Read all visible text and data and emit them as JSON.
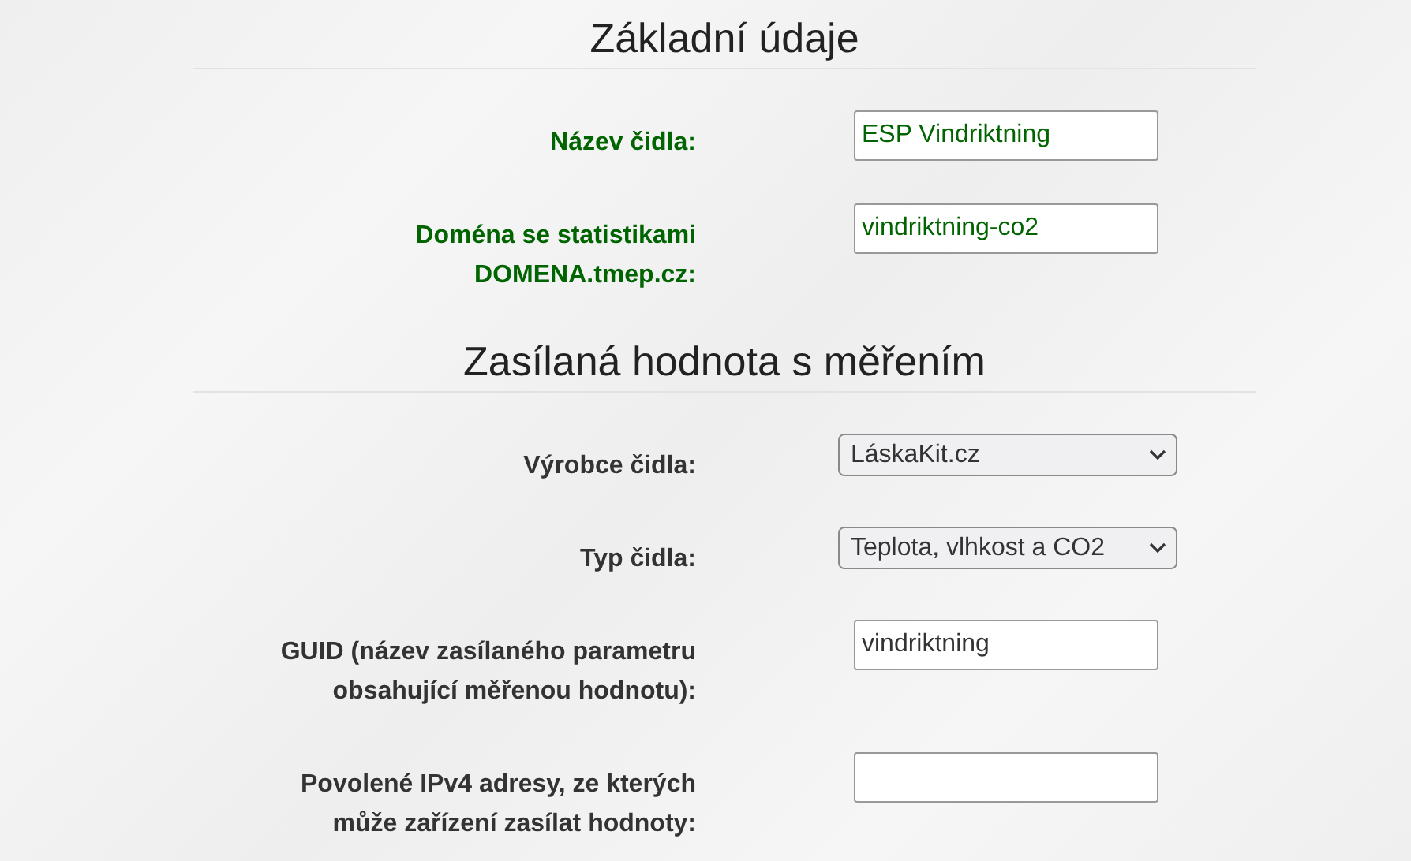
{
  "sections": [
    {
      "title": "Základní údaje",
      "color": "#006400",
      "fields": [
        {
          "kind": "text",
          "label": "Název čidla:",
          "value": "ESP Vindriktning"
        },
        {
          "kind": "text",
          "label": "Doména se statistikami DOMENA.tmep.cz:",
          "value": "vindriktning-co2"
        }
      ]
    },
    {
      "title": "Zasílaná hodnota s měřením",
      "color": "#333333",
      "fields": [
        {
          "kind": "select",
          "label": "Výrobce čidla:",
          "value": "LáskaKit.cz"
        },
        {
          "kind": "select",
          "label": "Typ čidla:",
          "value": "Teplota, vlhkost a CO2"
        },
        {
          "kind": "text",
          "label": "GUID (název zasílaného parametru obsahující měřenou hodnotu):",
          "value": "vindriktning"
        },
        {
          "kind": "text",
          "label": "Povolené IPv4 adresy, ze kterých může zařízení zasílat hodnoty:"
        }
      ]
    }
  ]
}
